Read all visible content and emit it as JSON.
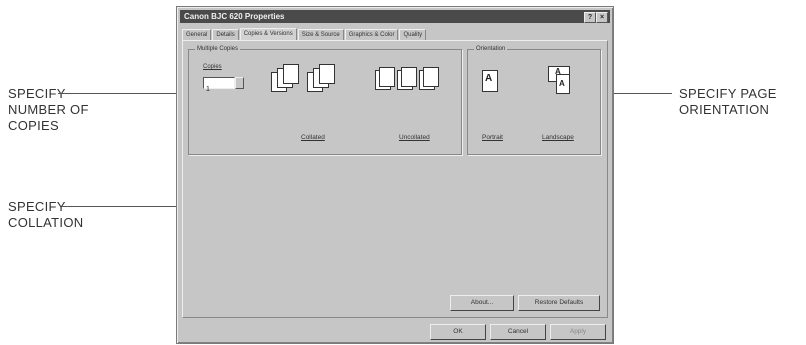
{
  "callouts": {
    "copies": [
      "SPECIFY",
      "NUMBER OF",
      "COPIES"
    ],
    "collation": [
      "SPECIFY",
      "COLLATION"
    ],
    "orientation": [
      "SPECIFY PAGE",
      "ORIENTATION"
    ]
  },
  "window": {
    "title": "Canon BJC 620 Properties",
    "help_btn": "?",
    "close_btn": "×"
  },
  "tabs": [
    "General",
    "Details",
    "Copies & Versions",
    "Size & Source",
    "Graphics & Color",
    "Quality"
  ],
  "multiple_copies": {
    "group_label": "Multiple Copies",
    "copies_label": "Copies",
    "copies_value": "1",
    "collated_label": "Collated",
    "uncollated_label": "Uncollated"
  },
  "orientation": {
    "group_label": "Orientation",
    "portrait_label": "Portrait",
    "landscape_label": "Landscape"
  },
  "buttons": {
    "about": "About...",
    "restore_defaults": "Restore Defaults",
    "ok": "OK",
    "cancel": "Cancel",
    "apply": "Apply"
  }
}
